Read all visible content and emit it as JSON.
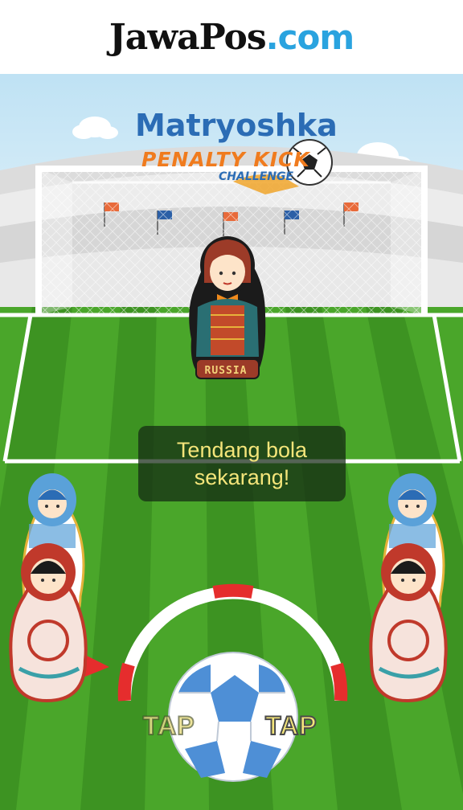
{
  "header": {
    "logo_main": "JawaPos",
    "logo_suffix": ".com"
  },
  "game": {
    "title_main": "Matryoshka",
    "title_sub1": "PENALTY KICK",
    "title_sub2": "CHALLENGE",
    "keeper_label": "RUSSIA",
    "message": "Tendang bola sekarang!",
    "tap_left": "TAP",
    "tap_right": "TAP"
  },
  "colors": {
    "sky": "#cfe8f5",
    "grass_light": "#54b030",
    "grass_dark": "#3f9a22",
    "accent_blue": "#2b6cb5",
    "accent_orange": "#f07b1e",
    "message_text": "#f4e57a"
  },
  "icons": [
    "soccer-ball-icon",
    "corner-flag-icon",
    "matryoshka-doll-icon"
  ]
}
